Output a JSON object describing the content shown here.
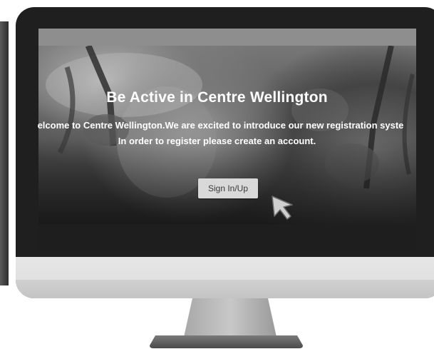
{
  "hero": {
    "title": "Be Active in Centre Wellington",
    "line1": "elcome to Centre Wellington.We are excited to introduce our new registration syste",
    "line2": "In order to register please create an account."
  },
  "signin": {
    "label": "Sign In/Up"
  },
  "icons": {
    "pointer": "mouse-pointer-icon"
  },
  "colors": {
    "bezel": "#1f1f1f",
    "chin": "#e0e0e0",
    "button": "#d9d9d9",
    "title_text": "#ffffff"
  }
}
